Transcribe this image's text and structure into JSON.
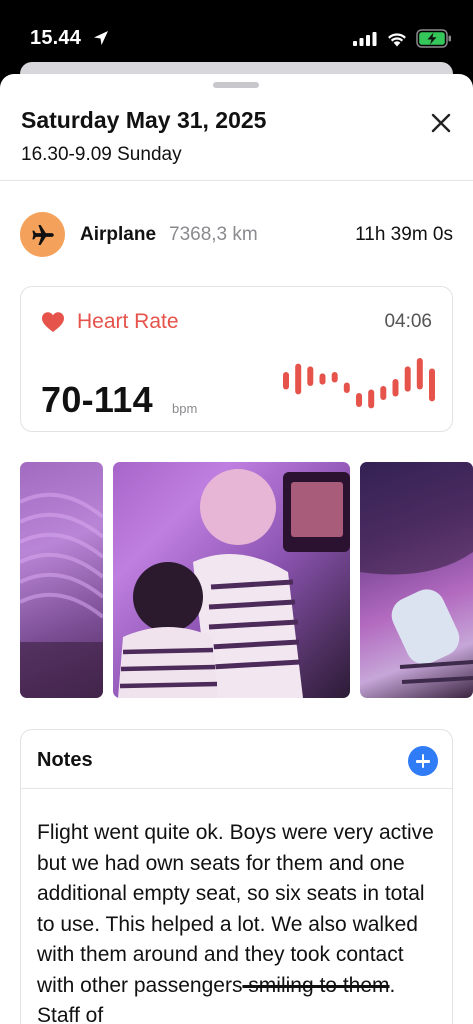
{
  "status_bar": {
    "time": "15.44",
    "icons": [
      "location-arrow-icon",
      "cellular-signal-icon",
      "wifi-icon",
      "battery-charging-icon"
    ]
  },
  "header": {
    "title": "Saturday May 31, 2025",
    "subtitle": "16.30-9.09 Sunday",
    "close_icon": "close-icon"
  },
  "activity": {
    "icon": "airplane-icon",
    "name": "Airplane",
    "distance": "7368,3 km",
    "duration": "11h 39m 0s",
    "icon_color": "#f4a25b"
  },
  "heart_rate": {
    "label": "Heart Rate",
    "time": "04:06",
    "value": "70-114",
    "unit": "bpm",
    "color": "#e5534b",
    "sparkline": [
      {
        "low": 0.3,
        "high": 0.55
      },
      {
        "low": 0.18,
        "high": 0.62
      },
      {
        "low": 0.22,
        "high": 0.5
      },
      {
        "low": 0.32,
        "high": 0.48
      },
      {
        "low": 0.3,
        "high": 0.45
      },
      {
        "low": 0.45,
        "high": 0.6
      },
      {
        "low": 0.6,
        "high": 0.8
      },
      {
        "low": 0.55,
        "high": 0.82
      },
      {
        "low": 0.5,
        "high": 0.7
      },
      {
        "low": 0.4,
        "high": 0.65
      },
      {
        "low": 0.22,
        "high": 0.58
      },
      {
        "low": 0.1,
        "high": 0.55
      },
      {
        "low": 0.25,
        "high": 0.72
      }
    ]
  },
  "photos": [
    {
      "name": "photo-blurred"
    },
    {
      "name": "photo-babies-window"
    },
    {
      "name": "photo-baby-bottle"
    }
  ],
  "notes": {
    "title": "Notes",
    "add_icon": "plus-circle-icon",
    "accent": "#2f7cf6",
    "text_before": "Flight went quite ok. Boys were very active but we had own seats for them and one additional empty seat, so six seats in total to use. This helped a lot. We also walked with them around and they took contact with other passengers",
    "text_struck": " smiling to them",
    "text_after": ". Staff of"
  }
}
